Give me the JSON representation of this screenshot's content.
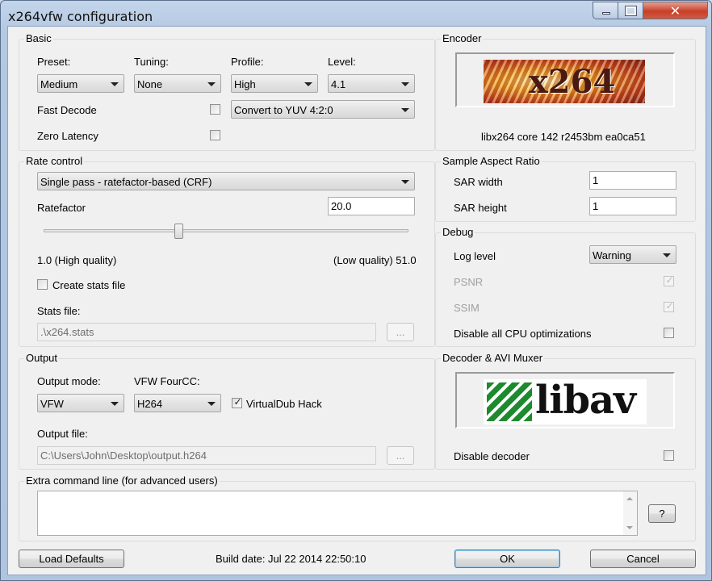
{
  "window": {
    "title": "x264vfw configuration",
    "close_glyph": "✕"
  },
  "basic": {
    "group_label": "Basic",
    "preset_label": "Preset:",
    "preset_value": "Medium",
    "tuning_label": "Tuning:",
    "tuning_value": "None",
    "profile_label": "Profile:",
    "profile_value": "High",
    "level_label": "Level:",
    "level_value": "4.1",
    "fast_decode_label": "Fast Decode",
    "colorspace_value": "Convert to YUV 4:2:0",
    "zero_latency_label": "Zero Latency"
  },
  "encoder": {
    "group_label": "Encoder",
    "logo_text": "x264",
    "version_text": "libx264 core 142 r2453bm ea0ca51"
  },
  "rate_control": {
    "group_label": "Rate control",
    "mode_value": "Single pass - ratefactor-based (CRF)",
    "ratefactor_label": "Ratefactor",
    "ratefactor_value": "20.0",
    "slider_fraction": 0.37,
    "min_label": "1.0 (High quality)",
    "max_label": "(Low quality) 51.0",
    "create_stats_label": "Create stats file",
    "stats_file_label": "Stats file:",
    "stats_file_value": ".\\x264.stats",
    "browse_label": "..."
  },
  "sar": {
    "group_label": "Sample Aspect Ratio",
    "width_label": "SAR width",
    "width_value": "1",
    "height_label": "SAR height",
    "height_value": "1"
  },
  "debug": {
    "group_label": "Debug",
    "log_level_label": "Log level",
    "log_level_value": "Warning",
    "psnr_label": "PSNR",
    "ssim_label": "SSIM",
    "disable_cpu_label": "Disable all CPU optimizations",
    "check_glyph": "✓"
  },
  "output": {
    "group_label": "Output",
    "mode_label": "Output mode:",
    "mode_value": "VFW",
    "fourcc_label": "VFW FourCC:",
    "fourcc_value": "H264",
    "vdub_hack_label": "VirtualDub Hack",
    "file_label": "Output file:",
    "file_value": "C:\\Users\\John\\Desktop\\output.h264",
    "browse_label": "..."
  },
  "decoder": {
    "group_label": "Decoder & AVI Muxer",
    "logo_text": "libav",
    "disable_decoder_label": "Disable decoder"
  },
  "extra": {
    "group_label": "Extra command line (for advanced users)",
    "help_label": "?"
  },
  "footer": {
    "load_defaults_label": "Load Defaults",
    "build_date": "Build date: Jul 22 2014 22:50:10",
    "ok_label": "OK",
    "cancel_label": "Cancel"
  },
  "colors": {
    "accent_border": "#3c7fb1",
    "libav_green": "#1e8a2e",
    "x264_orange": "#e0781b"
  }
}
